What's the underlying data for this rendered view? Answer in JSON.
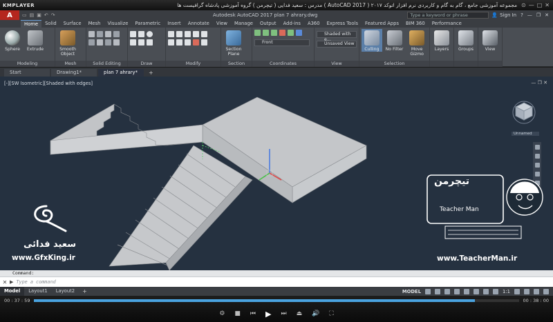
{
  "kmplayer": {
    "logo": "KMPLAYER",
    "title": "مجموعه آموزشی جامع ، گام به گام و کاربردی نرم افزار  اتوکد ۲۰۱۷ ( AutoCAD 2017 )   مدرس : سعید فدایی ( تیچرمن ) گروه آموزشی پادشاه گرافیست ها",
    "time_elapsed": "00 : 37 : 59",
    "time_total": "00 : 38 : 00",
    "progress": 0.91
  },
  "acad": {
    "logo": "A",
    "doc_title": "Autodesk AutoCAD 2017    plan 7 ahrary.dwg",
    "search_placeholder": "Type a keyword or phrase",
    "sign_in": "Sign In"
  },
  "ribbon": {
    "tabs": [
      "Home",
      "Solid",
      "Surface",
      "Mesh",
      "Visualize",
      "Parametric",
      "Insert",
      "Annotate",
      "View",
      "Manage",
      "Output",
      "Add-ins",
      "A360",
      "Express Tools",
      "Featured Apps",
      "BIM 360",
      "Performance"
    ],
    "active_tab": "Home",
    "panels": {
      "modeling": {
        "title": "Modeling",
        "sphere": "Sphere",
        "extrude": "Extrude"
      },
      "mesh": {
        "title": "Mesh",
        "smooth": "Smooth Object"
      },
      "solid_editing": {
        "title": "Solid Editing"
      },
      "draw": {
        "title": "Draw"
      },
      "modify": {
        "title": "Modify"
      },
      "section": {
        "title": "Section",
        "section_plane": "Section Plane"
      },
      "coordinates": {
        "title": "Coordinates",
        "view_dd": "Front"
      },
      "view": {
        "title": "View",
        "style_dd": "Shaded with e...",
        "unsaved": "Unsaved View"
      },
      "selection": {
        "title": "Selection",
        "culling": "Culling",
        "no_filter": "No Filter",
        "move_gizmo": "Move Gizmo"
      },
      "layers": {
        "title": "",
        "label": "Layers"
      },
      "groups": {
        "title": "",
        "label": "Groups"
      },
      "view2": {
        "title": "",
        "label": "View"
      }
    }
  },
  "file_tabs": [
    "Start",
    "Drawing1*",
    "plan 7 ahrary*"
  ],
  "active_file_tab": "plan 7 ahrary*",
  "viewport": {
    "label": "[-][SW Isometric][Shaded with edges]",
    "viewcube_label": "Unnamed"
  },
  "watermarks": {
    "left_name": "سعید فدائی",
    "left_site": "www.GfxKing.ir",
    "right_brand": "تیچرمن",
    "right_name": "Teacher Man",
    "right_site": "www.TeacherMan.ir"
  },
  "command": {
    "history": "Command:",
    "placeholder": "Type a command"
  },
  "layout_tabs": [
    "Model",
    "Layout1",
    "Layout2"
  ],
  "active_layout_tab": "Model",
  "status": {
    "model": "MODEL",
    "scale": "1:1"
  }
}
